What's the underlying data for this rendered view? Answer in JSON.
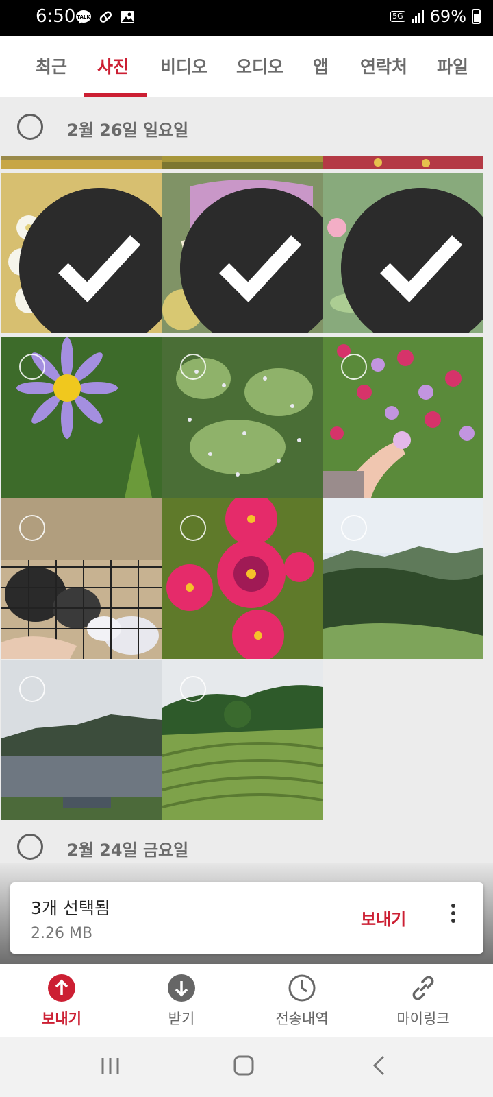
{
  "status_bar": {
    "time": "6:50",
    "network": "5G",
    "battery": "69%",
    "notification_icons": [
      "talk-icon",
      "pill-icon",
      "image-icon"
    ]
  },
  "tabs": [
    {
      "label": "최근",
      "active": false
    },
    {
      "label": "사진",
      "active": true
    },
    {
      "label": "비디오",
      "active": false
    },
    {
      "label": "오디오",
      "active": false
    },
    {
      "label": "앱",
      "active": false
    },
    {
      "label": "연락처",
      "active": false
    },
    {
      "label": "파일",
      "active": false
    }
  ],
  "groups": [
    {
      "date": "2월 26일 일요일"
    },
    {
      "date": "2월 24일 금요일"
    }
  ],
  "photos": [
    {
      "subject": "white-chrysanthemums",
      "selected": true
    },
    {
      "subject": "purple-flower-heart-bed",
      "selected": true
    },
    {
      "subject": "pink-roses",
      "selected": true
    },
    {
      "subject": "purple-aster",
      "selected": false
    },
    {
      "subject": "white-heather-shrub",
      "selected": false
    },
    {
      "subject": "cosmos-field-hand",
      "selected": false
    },
    {
      "subject": "rabbits-in-cage",
      "selected": false
    },
    {
      "subject": "magenta-cosmos",
      "selected": false
    },
    {
      "subject": "green-valley",
      "selected": false
    },
    {
      "subject": "misty-lake",
      "selected": false
    },
    {
      "subject": "tea-plantation",
      "selected": false
    }
  ],
  "selection": {
    "count_label": "3개 선택됨",
    "size": "2.26 MB",
    "send_label": "보내기"
  },
  "bottom_nav": [
    {
      "label": "보내기",
      "icon": "upload-arrow-icon",
      "active": true
    },
    {
      "label": "받기",
      "icon": "download-arrow-icon",
      "active": false
    },
    {
      "label": "전송내역",
      "icon": "clock-icon",
      "active": false
    },
    {
      "label": "마이링크",
      "icon": "link-icon",
      "active": false
    }
  ],
  "colors": {
    "accent": "#cc1f33",
    "inactive_text": "#6b6b6b",
    "background": "#ececec"
  }
}
